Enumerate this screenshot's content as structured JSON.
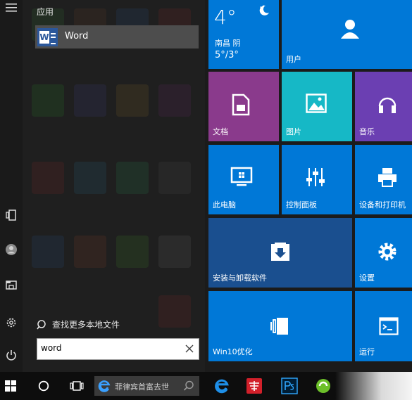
{
  "start_menu": {
    "section_header": "应用",
    "best_match": {
      "label": "Word"
    },
    "search_more": "查找更多本地文件",
    "search": {
      "value": "word",
      "placeholder": ""
    }
  },
  "tiles": {
    "weather": {
      "temp": "4°",
      "city": "南昌 阴",
      "range": "5°/3°"
    },
    "user": "用户",
    "documents": "文档",
    "pictures": "图片",
    "music": "音乐",
    "this_pc": "此电脑",
    "control_panel": "控制面板",
    "devices_printers": "设备和打印机",
    "install_uninstall": "安装与卸载软件",
    "settings": "设置",
    "win10_optimize": "Win10优化",
    "run": "运行"
  },
  "taskbar": {
    "search_text": "菲律宾首富去世"
  },
  "colors": {
    "tile_blue": "#0078d7",
    "tile_dark_blue": "#1a4f8f",
    "tile_purple_doc": "#8a3a8c",
    "tile_teal": "#16b8c6",
    "tile_purple_music": "#6b3fb2",
    "word_blue": "#2b579a"
  },
  "icons": {
    "hamburger": "hamburger-icon",
    "tablet": "tablet-mode-icon",
    "user": "user-avatar-icon",
    "explorer": "file-explorer-icon",
    "settings": "gear-icon",
    "power": "power-icon"
  }
}
